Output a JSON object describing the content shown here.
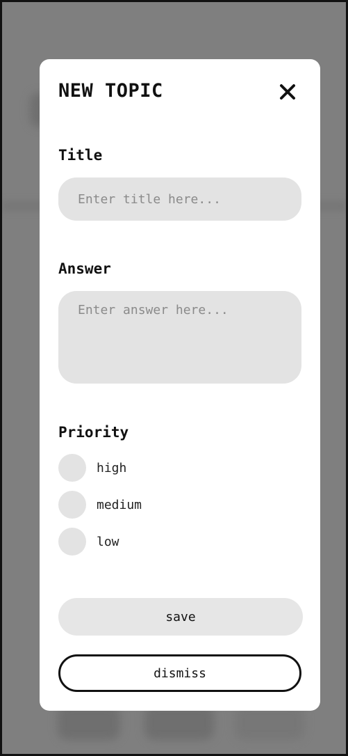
{
  "modal": {
    "title": "NEW TOPIC",
    "close_icon": "close-icon"
  },
  "form": {
    "title_label": "Title",
    "title_value": "",
    "title_placeholder": "Enter title here...",
    "answer_label": "Answer",
    "answer_value": "",
    "answer_placeholder": "Enter answer here...",
    "priority_label": "Priority",
    "priority_options": [
      {
        "label": "high",
        "selected": false
      },
      {
        "label": "medium",
        "selected": false
      },
      {
        "label": "low",
        "selected": false
      }
    ]
  },
  "actions": {
    "save_label": "save",
    "dismiss_label": "dismiss"
  },
  "colors": {
    "overlay": "#7f7f7f",
    "modal_bg": "#ffffff",
    "field_bg": "#e3e3e3",
    "text": "#111111"
  }
}
